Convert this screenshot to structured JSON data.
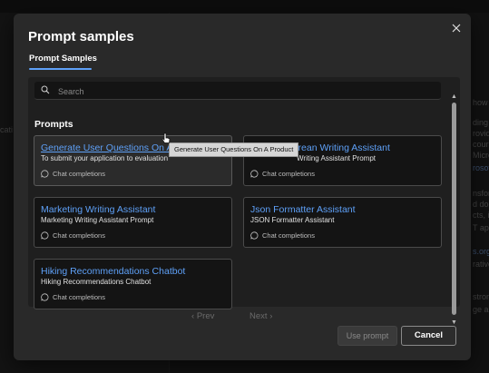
{
  "background": {
    "left_text": "cati",
    "right_lines": [
      "how",
      "ding",
      "rovid",
      "cours",
      "Micro",
      "rosoft",
      "",
      "nsfor",
      "d doc",
      "cts, i",
      "T app",
      "",
      "s.org",
      "rative",
      "",
      "stron",
      "ge and"
    ]
  },
  "dialog": {
    "title": "Prompt samples",
    "tab": "Prompt Samples",
    "search_placeholder": "Search",
    "section_title": "Prompts",
    "cards": [
      {
        "title": "Generate User Questions On A P...",
        "desc": "To submit your application to evaluation",
        "meta": "Chat completions"
      },
      {
        "title": "Shakespearean Writing Assistant",
        "desc": "Writing Assistant Prompt",
        "meta": "Chat completions"
      },
      {
        "title": "Marketing Writing Assistant",
        "desc": "Marketing Writing Assistant Prompt",
        "meta": "Chat completions"
      },
      {
        "title": "Json Formatter Assistant",
        "desc": "JSON Formatter Assistant",
        "meta": "Chat completions"
      },
      {
        "title": "Hiking Recommendations Chatbot",
        "desc": "Hiking Recommendations Chatbot",
        "meta": "Chat completions"
      }
    ],
    "pager": {
      "prev": "Prev",
      "next": "Next"
    },
    "use_prompt": "Use prompt",
    "cancel": "Cancel",
    "tooltip": "Generate User Questions On A Product"
  },
  "colors": {
    "accent": "#5ea0f7",
    "card_bg": "#141414",
    "dialog_bg": "#292929"
  }
}
